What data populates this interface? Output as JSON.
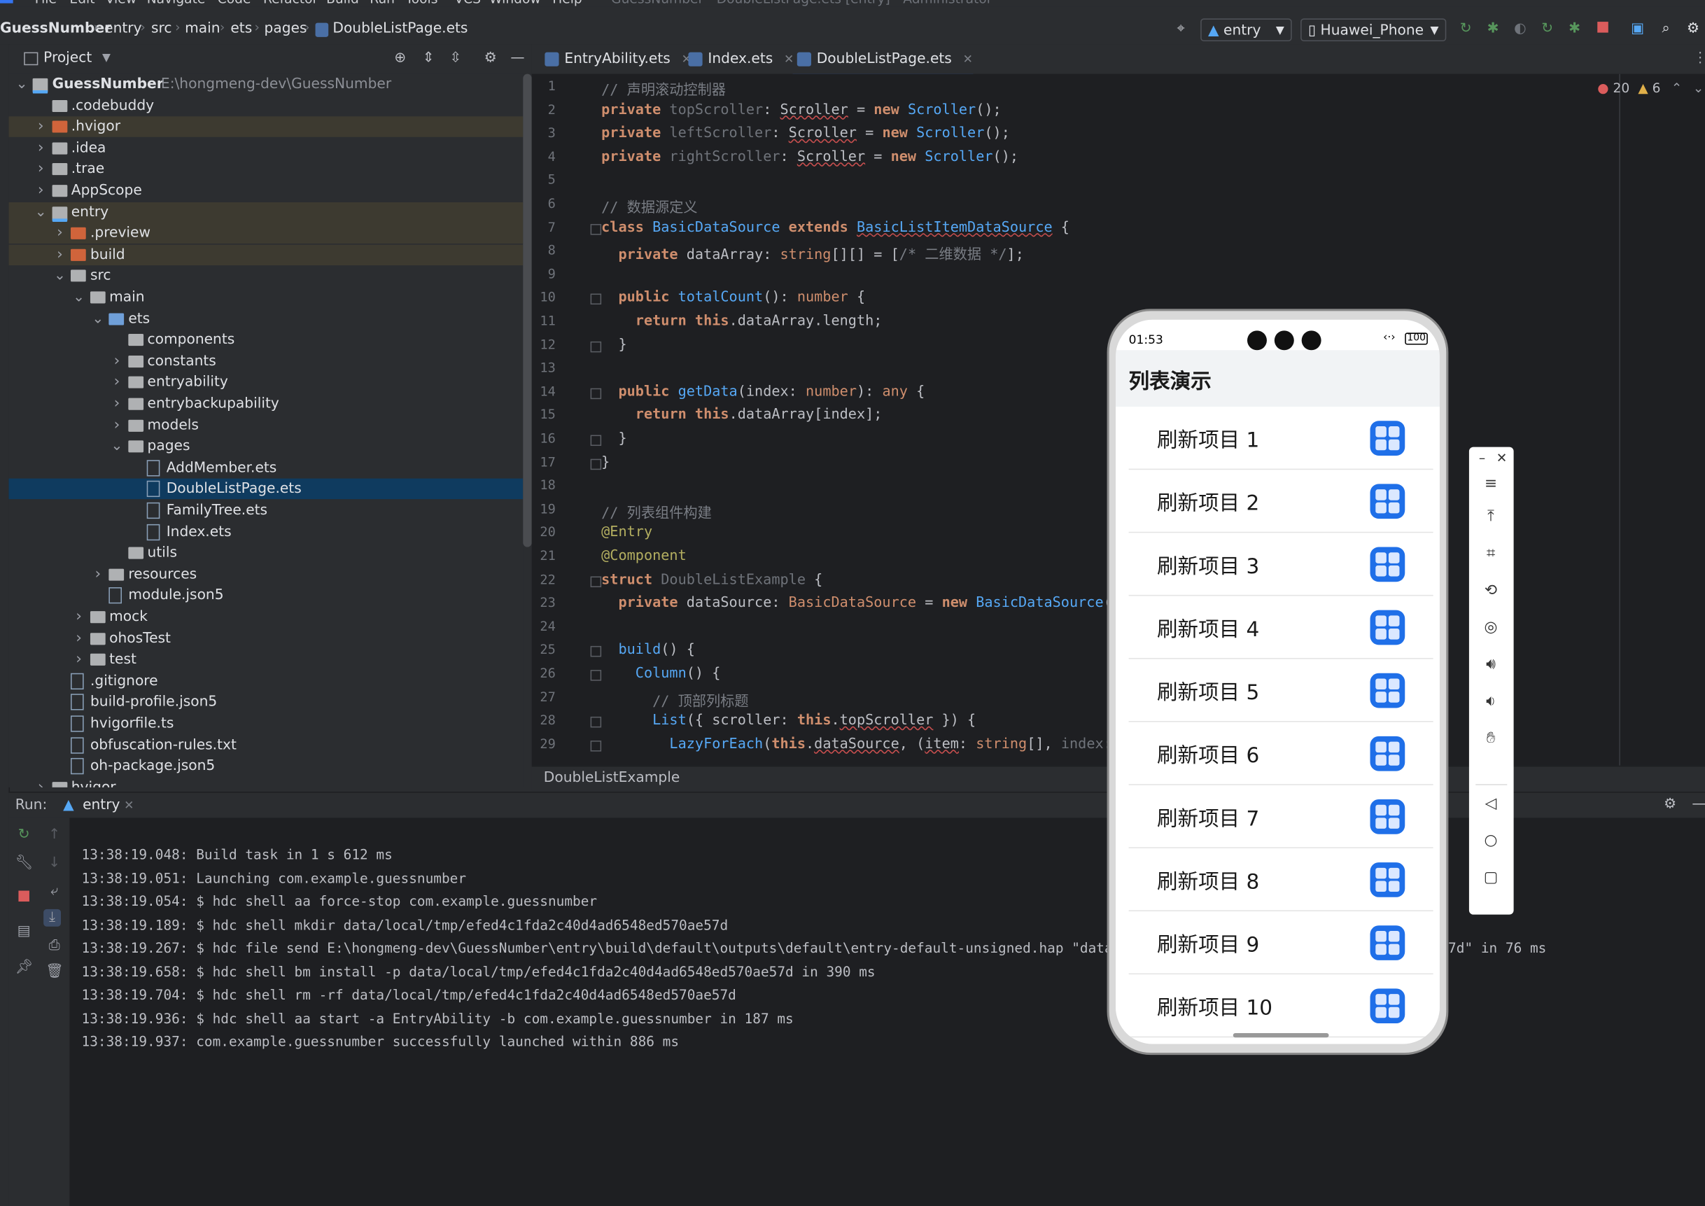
{
  "menu": [
    "File",
    "Edit",
    "View",
    "Navigate",
    "Code",
    "Refactor",
    "Build",
    "Run",
    "Tools",
    "VCS",
    "Window",
    "Help"
  ],
  "window_title": "GuessNumber - DoubleListPage.ets [entry] - Administrator",
  "breadcrumb": [
    "GuessNumber",
    "entry",
    "src",
    "main",
    "ets",
    "pages",
    "DoubleListPage.ets"
  ],
  "toolbar": {
    "run_config": "entry",
    "device": "Huawei_Phone"
  },
  "project_panel": {
    "title": "Project",
    "tree": [
      {
        "label": "GuessNumber",
        "path": "E:\\hongmeng-dev\\GuessNumber",
        "depth": 0,
        "arrow": "down",
        "icon": "module",
        "bold": true
      },
      {
        "label": ".codebuddy",
        "depth": 1,
        "arrow": "",
        "icon": "folder"
      },
      {
        "label": ".hvigor",
        "depth": 1,
        "arrow": "right",
        "icon": "folder-ex",
        "hl": "excl"
      },
      {
        "label": ".idea",
        "depth": 1,
        "arrow": "right",
        "icon": "folder"
      },
      {
        "label": ".trae",
        "depth": 1,
        "arrow": "right",
        "icon": "folder"
      },
      {
        "label": "AppScope",
        "depth": 1,
        "arrow": "right",
        "icon": "folder"
      },
      {
        "label": "entry",
        "depth": 1,
        "arrow": "down",
        "icon": "module",
        "hl": "excl"
      },
      {
        "label": ".preview",
        "depth": 2,
        "arrow": "right",
        "icon": "folder-ex",
        "hl": "excl"
      },
      {
        "label": "build",
        "depth": 2,
        "arrow": "right",
        "icon": "folder-ex",
        "hl": "excl"
      },
      {
        "label": "src",
        "depth": 2,
        "arrow": "down",
        "icon": "folder"
      },
      {
        "label": "main",
        "depth": 3,
        "arrow": "down",
        "icon": "folder"
      },
      {
        "label": "ets",
        "depth": 4,
        "arrow": "down",
        "icon": "folder-src"
      },
      {
        "label": "components",
        "depth": 5,
        "arrow": "",
        "icon": "folder"
      },
      {
        "label": "constants",
        "depth": 5,
        "arrow": "right",
        "icon": "folder"
      },
      {
        "label": "entryability",
        "depth": 5,
        "arrow": "right",
        "icon": "folder"
      },
      {
        "label": "entrybackupability",
        "depth": 5,
        "arrow": "right",
        "icon": "folder"
      },
      {
        "label": "models",
        "depth": 5,
        "arrow": "right",
        "icon": "folder"
      },
      {
        "label": "pages",
        "depth": 5,
        "arrow": "down",
        "icon": "folder"
      },
      {
        "label": "AddMember.ets",
        "depth": 6,
        "arrow": "",
        "icon": "file"
      },
      {
        "label": "DoubleListPage.ets",
        "depth": 6,
        "arrow": "",
        "icon": "file",
        "hl": "sel"
      },
      {
        "label": "FamilyTree.ets",
        "depth": 6,
        "arrow": "",
        "icon": "file"
      },
      {
        "label": "Index.ets",
        "depth": 6,
        "arrow": "",
        "icon": "file"
      },
      {
        "label": "utils",
        "depth": 5,
        "arrow": "",
        "icon": "folder"
      },
      {
        "label": "resources",
        "depth": 4,
        "arrow": "right",
        "icon": "folder"
      },
      {
        "label": "module.json5",
        "depth": 4,
        "arrow": "",
        "icon": "file"
      },
      {
        "label": "mock",
        "depth": 3,
        "arrow": "right",
        "icon": "folder"
      },
      {
        "label": "ohosTest",
        "depth": 3,
        "arrow": "right",
        "icon": "folder"
      },
      {
        "label": "test",
        "depth": 3,
        "arrow": "right",
        "icon": "folder"
      },
      {
        "label": ".gitignore",
        "depth": 2,
        "arrow": "",
        "icon": "file"
      },
      {
        "label": "build-profile.json5",
        "depth": 2,
        "arrow": "",
        "icon": "file"
      },
      {
        "label": "hvigorfile.ts",
        "depth": 2,
        "arrow": "",
        "icon": "file"
      },
      {
        "label": "obfuscation-rules.txt",
        "depth": 2,
        "arrow": "",
        "icon": "file"
      },
      {
        "label": "oh-package.json5",
        "depth": 2,
        "arrow": "",
        "icon": "file"
      },
      {
        "label": "hvigor",
        "depth": 1,
        "arrow": "right",
        "icon": "folder"
      }
    ]
  },
  "editor": {
    "tabs": [
      {
        "label": "EntryAbility.ets",
        "active": false
      },
      {
        "label": "Index.ets",
        "active": false
      },
      {
        "label": "DoubleListPage.ets",
        "active": true
      }
    ],
    "errors": "20",
    "warnings": "6",
    "lines": [
      "<span class=\"cm\">// 声明滚动控制器</span>",
      "<span class=\"k\">private</span> <span class=\"dim\">topScroller</span>: <span class=\"und\">Scroller</span> = <span class=\"k\">new</span> <span class=\"ty\">Scroller</span>();",
      "<span class=\"k\">private</span> <span class=\"dim\">leftScroller</span>: <span class=\"und\">Scroller</span> = <span class=\"k\">new</span> <span class=\"ty\">Scroller</span>();",
      "<span class=\"k\">private</span> <span class=\"dim\">rightScroller</span>: <span class=\"und\">Scroller</span> = <span class=\"k\">new</span> <span class=\"ty\">Scroller</span>();",
      "",
      "<span class=\"cm\">// 数据源定义</span>",
      "<span class=\"k\">class</span> <span class=\"ty\">BasicDataSource</span> <span class=\"k\">extends</span> <span class=\"ty und\">BasicListItemDataSource</span> {",
      "  <span class=\"k\">private</span> dataArray: <span class=\"kw\">string</span>[][] = [<span class=\"cm\">/* 二维数据 */</span>];",
      "",
      "  <span class=\"k\">public</span> <span class=\"fn\">totalCount</span>(): <span class=\"kw\">number</span> {",
      "    <span class=\"k\">return</span> <span class=\"k\">this</span>.dataArray.length;",
      "  }",
      "",
      "  <span class=\"k\">public</span> <span class=\"fn\">getData</span>(index: <span class=\"kw\">number</span>): <span class=\"kw\">any</span> {",
      "    <span class=\"k\">return</span> <span class=\"k\">this</span>.dataArray[index];",
      "  }",
      "}",
      "",
      "<span class=\"cm\">// 列表组件构建</span>",
      "<span class=\"ann\">@Entry</span>",
      "<span class=\"ann\">@Component</span>",
      "<span class=\"k\">struct</span> <span class=\"dim\">DoubleListExample</span> {",
      "  <span class=\"k\">private</span> dataSource: <span class=\"kw\">BasicDataSource</span> = <span class=\"k\">new</span> <span class=\"ty\">BasicDataSource</span>(",
      "",
      "  <span class=\"fn\">build</span>() {",
      "    <span class=\"ty\">Column</span>() {",
      "      <span class=\"cm\">// 顶部列标题</span>",
      "      <span class=\"ty\">List</span>({ scroller: <span class=\"k\">this</span>.<span class=\"und\">topScroller</span> }) {",
      "        <span class=\"ty\">LazyForEach</span>(<span class=\"k\">this</span>.<span class=\"und\">dataSource</span>, (<span class=\"und\">item</span>: <span class=\"kw\">string</span>[], <span class=\"dim\">index</span>:"
    ],
    "breadcrumb": "DoubleListExample"
  },
  "run_panel": {
    "label": "Run:",
    "tab": "entry",
    "log": [
      "13:38:19.048: Build task in 1 s 612 ms",
      "13:38:19.051: Launching com.example.guessnumber",
      "13:38:19.054: $ hdc shell aa force-stop com.example.guessnumber",
      "13:38:19.189: $ hdc shell mkdir data/local/tmp/efed4c1fda2c40d4ad6548ed570ae57d",
      "13:38:19.267: $ hdc file send E:\\hongmeng-dev\\GuessNumber\\entry\\build\\default\\outputs\\default\\entry-default-unsigned.hap \"data/local/tmp/efed4c1fda2c40d4ad6548ed570ae57d\" in 76 ms",
      "13:38:19.658: $ hdc shell bm install -p data/local/tmp/efed4c1fda2c40d4ad6548ed570ae57d in 390 ms",
      "13:38:19.704: $ hdc shell rm -rf data/local/tmp/efed4c1fda2c40d4ad6548ed570ae57d",
      "13:38:19.936: $ hdc shell aa start -a EntryAbility -b com.example.guessnumber in 187 ms",
      "13:38:19.937: com.example.guessnumber successfully launched within 886 ms"
    ]
  },
  "phone": {
    "time": "01:53",
    "battery": "100",
    "title": "列表演示",
    "items": [
      "刷新项目 1",
      "刷新项目 2",
      "刷新项目 3",
      "刷新项目 4",
      "刷新项目 5",
      "刷新项目 6",
      "刷新项目 7",
      "刷新项目 8",
      "刷新项目 9",
      "刷新项目 10"
    ]
  },
  "colors": {
    "accent": "#3574f0",
    "app_icon": "#1f6fe8",
    "selected_row": "#0f3b5f",
    "excluded_row": "#3d3a30"
  }
}
